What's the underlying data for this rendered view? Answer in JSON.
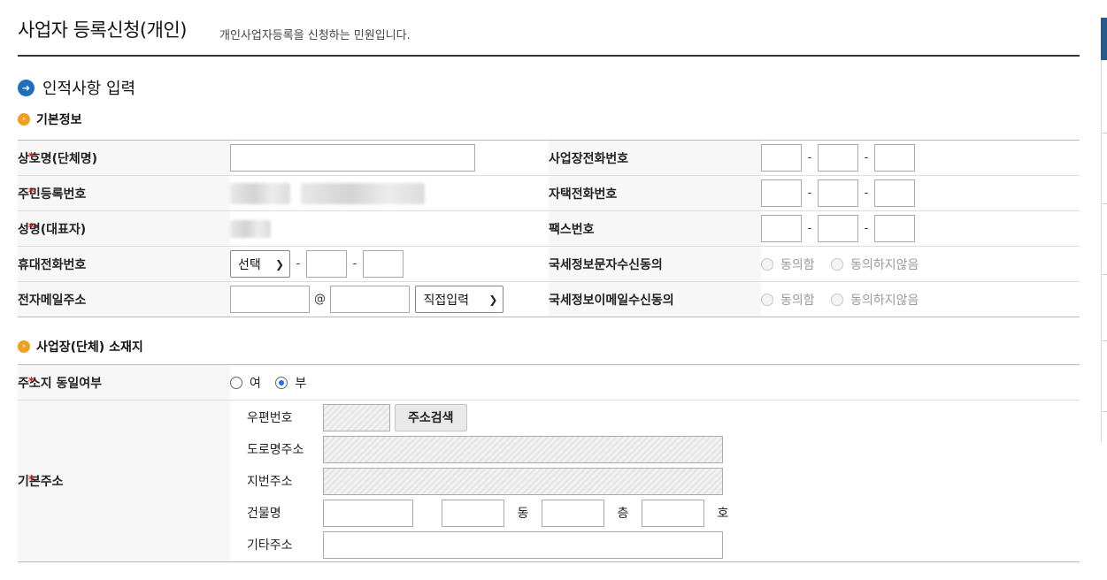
{
  "header": {
    "title": "사업자 등록신청(개인)",
    "subtitle": "개인사업자등록을 신청하는 민원입니다."
  },
  "section": {
    "title": "인적사항 입력"
  },
  "basic_info": {
    "heading": "기본정보",
    "trade_name_label": "상호명(단체명)",
    "resident_no_label": "주민등록번호",
    "name_label": "성명(대표자)",
    "mobile_label": "휴대전화번호",
    "mobile_select": "선택",
    "email_label": "전자메일주소",
    "email_at": "@",
    "email_domain_select": "직접입력",
    "biz_phone_label": "사업장전화번호",
    "home_phone_label": "자택전화번호",
    "fax_label": "팩스번호",
    "sms_consent_label": "국세정보문자수신동의",
    "email_consent_label": "국세정보이메일수신동의",
    "agree": "동의함",
    "disagree": "동의하지않음",
    "dash": "-"
  },
  "location": {
    "heading": "사업장(단체) 소재지",
    "same_address_label": "주소지 동일여부",
    "yes": "여",
    "no": "부",
    "selected": "부",
    "base_address_label": "기본주소",
    "postal_label": "우편번호",
    "search_button": "주소검색",
    "road_address_label": "도로명주소",
    "lot_address_label": "지번주소",
    "building_label": "건물명",
    "dong_unit": "동",
    "floor_unit": "층",
    "ho_unit": "호",
    "other_address_label": "기타주소"
  }
}
